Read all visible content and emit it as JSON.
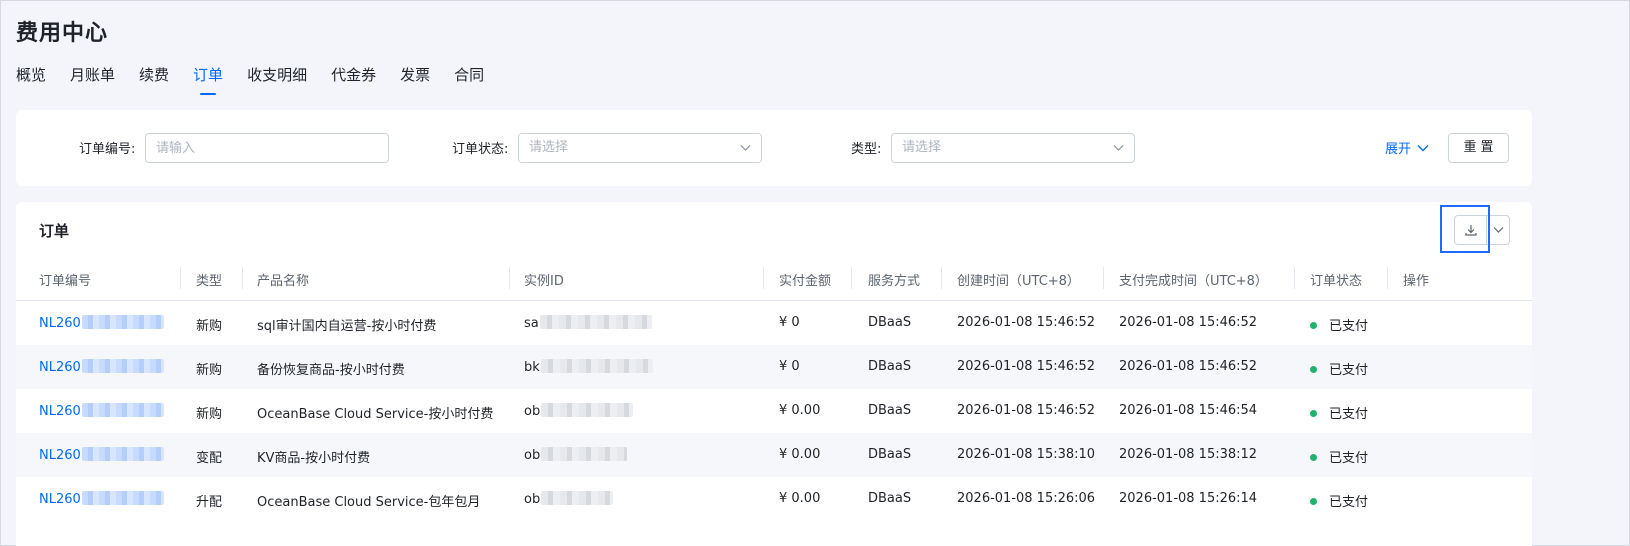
{
  "page": {
    "title": "费用中心"
  },
  "tabs": [
    {
      "label": "概览",
      "active": false
    },
    {
      "label": "月账单",
      "active": false
    },
    {
      "label": "续费",
      "active": false
    },
    {
      "label": "订单",
      "active": true
    },
    {
      "label": "收支明细",
      "active": false
    },
    {
      "label": "代金券",
      "active": false
    },
    {
      "label": "发票",
      "active": false
    },
    {
      "label": "合同",
      "active": false
    }
  ],
  "filters": {
    "order_no_label": "订单编号:",
    "order_no_placeholder": "请输入",
    "status_label": "订单状态:",
    "status_placeholder": "请选择",
    "type_label": "类型:",
    "type_placeholder": "请选择",
    "expand_label": "展开",
    "reset_label": "重置"
  },
  "orders": {
    "title": "订单",
    "columns": [
      "订单编号",
      "类型",
      "产品名称",
      "实例ID",
      "实付金额",
      "服务方式",
      "创建时间（UTC+8）",
      "支付完成时间（UTC+8）",
      "订单状态",
      "操作"
    ],
    "rows": [
      {
        "order_no": "NL260",
        "type": "新购",
        "product": "sql审计国内自运营-按小时付费",
        "instance": "sa",
        "amount": "¥ 0",
        "service": "DBaaS",
        "created": "2026-01-08 15:46:52",
        "paid": "2026-01-08 15:46:52",
        "status": "已支付"
      },
      {
        "order_no": "NL260",
        "type": "新购",
        "product": "备份恢复商品-按小时付费",
        "instance": "bk",
        "amount": "¥ 0",
        "service": "DBaaS",
        "created": "2026-01-08 15:46:52",
        "paid": "2026-01-08 15:46:52",
        "status": "已支付"
      },
      {
        "order_no": "NL260",
        "type": "新购",
        "product": "OceanBase Cloud Service-按小时付费",
        "instance": "ob",
        "amount": "¥ 0.00",
        "service": "DBaaS",
        "created": "2026-01-08 15:46:52",
        "paid": "2026-01-08 15:46:54",
        "status": "已支付"
      },
      {
        "order_no": "NL260",
        "type": "变配",
        "product": "KV商品-按小时付费",
        "instance": "ob",
        "amount": "¥ 0.00",
        "service": "DBaaS",
        "created": "2026-01-08 15:38:10",
        "paid": "2026-01-08 15:38:12",
        "status": "已支付"
      },
      {
        "order_no": "NL260",
        "type": "升配",
        "product": "OceanBase Cloud Service-包年包月",
        "instance": "ob",
        "amount": "¥ 0.00",
        "service": "DBaaS",
        "created": "2026-01-08 15:26:06",
        "paid": "2026-01-08 15:26:14",
        "status": "已支付"
      }
    ]
  },
  "colors": {
    "accent": "#006aff",
    "paid": "#1fb36b"
  },
  "icons": {
    "download": "download-icon",
    "more": "chevron-down-icon",
    "expand": "chevron-down-icon"
  }
}
